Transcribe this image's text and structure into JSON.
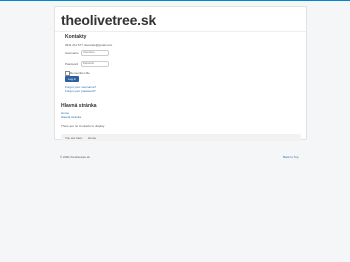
{
  "site": {
    "title": "theolivetree.sk"
  },
  "contacts": {
    "title": "Kontakty",
    "phone_email": "0911 211 577 olivecafe@gmail.com"
  },
  "login": {
    "username_label": "Username",
    "username_placeholder": "Username",
    "password_label": "Password",
    "password_placeholder": "Password",
    "remember_label": "Remember Me",
    "submit_label": "Log in",
    "forgot_username": "Forgot your username?",
    "forgot_password": "Forgot your password?"
  },
  "main": {
    "title": "Hlavná stránka",
    "nav_home": "Home",
    "nav_main_page": "Hlavná stránka",
    "empty_message": "There are no Contacts to display"
  },
  "breadcrumb": {
    "prefix": "You are here:",
    "current": "Home"
  },
  "footer": {
    "copyright": "© 2021 theolivetree.sk",
    "back_to_top": "Back to Top"
  },
  "colors": {
    "accent_bar": "#0088cc",
    "button": "#2c5f9e",
    "link": "#2b6cb0",
    "background": "#f4f6f7"
  }
}
